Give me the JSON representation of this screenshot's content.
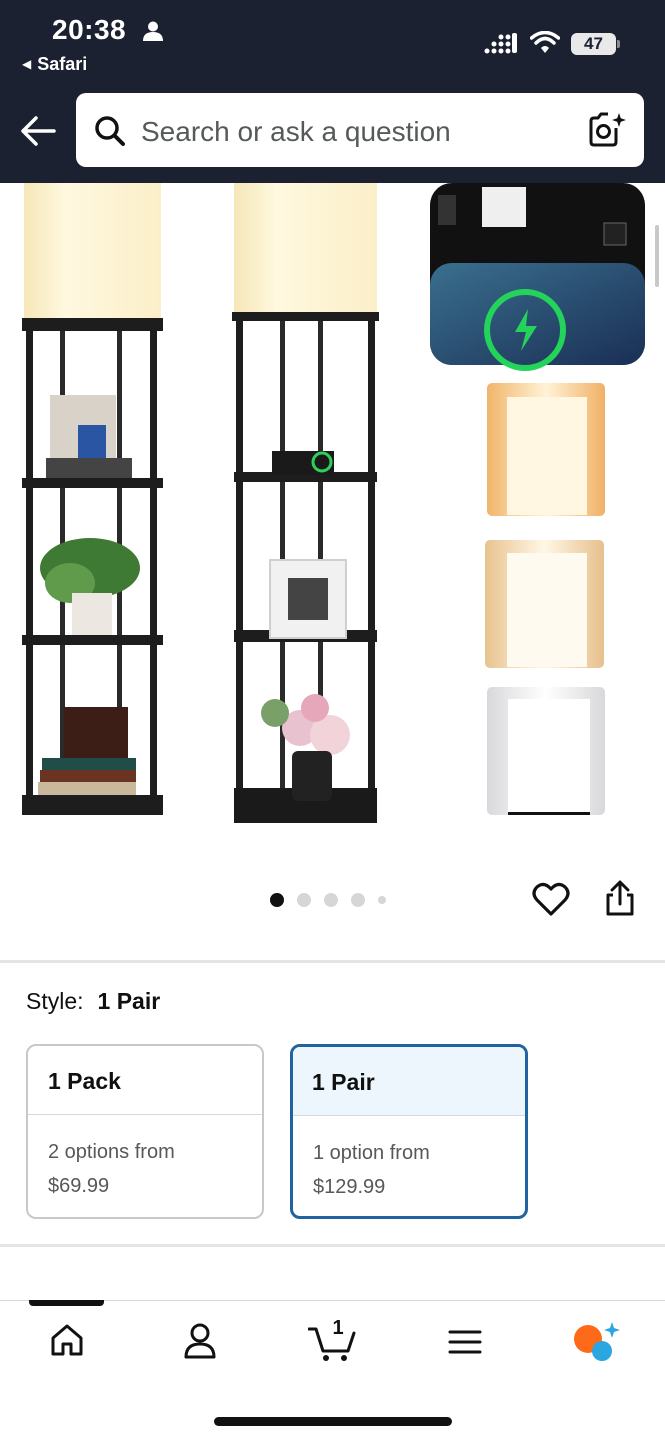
{
  "status_bar": {
    "time": "20:38",
    "back_app": "Safari",
    "battery": "47"
  },
  "search": {
    "placeholder": "Search or ask a question"
  },
  "gallery": {
    "dots_total": 5,
    "active_index": 0
  },
  "style": {
    "label": "Style:",
    "value": "1 Pair"
  },
  "options": [
    {
      "title": "1 Pack",
      "line1": "2 options from",
      "price": "$69.99",
      "selected": false
    },
    {
      "title": "1 Pair",
      "line1": "1 option from",
      "price": "$129.99",
      "selected": true
    }
  ],
  "nav": {
    "cart_count": "1",
    "items": [
      "home-icon",
      "account-icon",
      "cart-icon",
      "menu-icon",
      "rufus-icon"
    ]
  },
  "colors": {
    "header_bg": "#1b2131",
    "selected_border": "#2162a1",
    "selected_head_bg": "#edf6fd"
  }
}
